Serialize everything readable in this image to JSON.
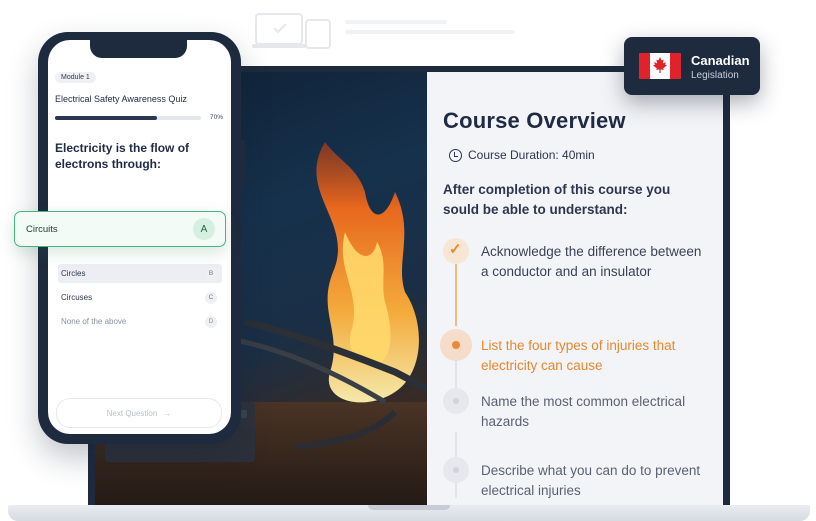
{
  "phone": {
    "module_label": "Module 1",
    "quiz_title": "Electrical Safety Awareness Quiz",
    "progress_fraction": 0.7,
    "progress_label": "70%",
    "question": "Electricity is the flow of electrons through:",
    "selected_answer": {
      "label": "Circuits",
      "key": "A"
    },
    "options": [
      {
        "label": "Circles",
        "key": "B"
      },
      {
        "label": "Circuses",
        "key": "C"
      },
      {
        "label": "None of the above",
        "key": "D"
      }
    ],
    "next_button": {
      "label": "Next Question",
      "icon": "arrow-right-icon"
    }
  },
  "badge": {
    "title": "Canadian",
    "subtitle": "Legislation",
    "flag_icon": "canada-flag-icon",
    "colors": {
      "background": "#1e2a3e",
      "flag_red": "#e0222b"
    }
  },
  "course": {
    "title": "Course Overview",
    "duration_icon": "clock-icon",
    "duration": "Course Duration: 40min",
    "intro": "After completion of this course you sould be able to understand:",
    "steps": [
      {
        "text": "Acknowledge the difference between a conductor and an insulator",
        "status": "done"
      },
      {
        "text": "List the four types of injuries that electricity can cause",
        "status": "active"
      },
      {
        "text": "Name the most common electrical hazards",
        "status": "todo"
      },
      {
        "text": "Describe what you can do to prevent electrical injuries",
        "status": "todo"
      }
    ],
    "colors": {
      "accent": "#e8872c",
      "text": "#2c3650",
      "panel": "#f3f4f7"
    }
  },
  "colors": {
    "device_frame": "#1e2a3e",
    "correct_border": "#49b57e"
  }
}
